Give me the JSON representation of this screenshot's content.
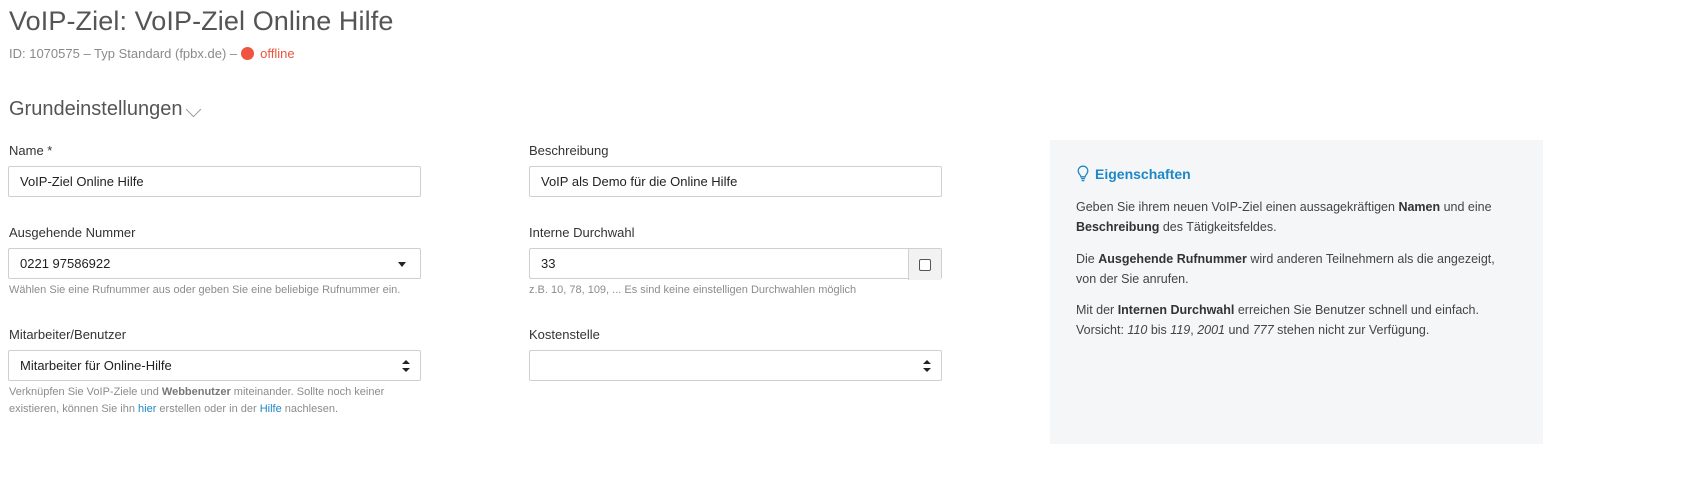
{
  "header": {
    "title": "VoIP-Ziel: VoIP-Ziel Online Hilfe",
    "meta": "ID: 1070575 – Typ Standard (fpbx.de) –",
    "status_label": "offline",
    "status_color": "#f0533f"
  },
  "section": {
    "title": "Grundeinstellungen",
    "toggle_icon": "chevron-down-icon"
  },
  "form": {
    "name": {
      "label": "Name *",
      "value": "VoIP-Ziel Online Hilfe"
    },
    "description": {
      "label": "Beschreibung",
      "value": "VoIP als Demo für die Online Hilfe"
    },
    "outgoing_number": {
      "label": "Ausgehende Nummer",
      "value": "0221 97586922",
      "help": "Wählen Sie eine Rufnummer aus oder geben Sie eine beliebige Rufnummer ein."
    },
    "internal_extension": {
      "label": "Interne Durchwahl",
      "value": "33",
      "help": "z.B. 10, 78, 109, ... Es sind keine einstelligen Durchwahlen möglich",
      "checkbox_checked": false
    },
    "employee": {
      "label": "Mitarbeiter/Benutzer",
      "value": "Mitarbeiter für Online-Hilfe",
      "help": {
        "p1": "Verknüpfen Sie VoIP-Ziele und ",
        "b1": "Webbenutzer",
        "p2": " miteinander. Sollte noch keiner",
        "p3": "existieren, können Sie ihn ",
        "link_here": "hier",
        "p4": " erstellen oder in der ",
        "link_help": "Hilfe",
        "p5": " nachlesen."
      }
    },
    "cost_center": {
      "label": "Kostenstelle",
      "value": ""
    }
  },
  "info_panel": {
    "title": "Eigenschaften",
    "icon": "lightbulb-icon",
    "accent_color": "#1e88c7",
    "p1": {
      "a": "Geben Sie ihrem neuen VoIP-Ziel einen aussagekräftigen ",
      "b": "Namen",
      "c": " und eine",
      "d": "Beschreibung",
      "e": " des Tätigkeitsfeldes."
    },
    "p2": {
      "a": "Die ",
      "b": "Ausgehende Rufnummer",
      "c": " wird anderen Teilnehmern als die angezeigt,",
      "d": "von der Sie anrufen."
    },
    "p3": {
      "a": "Mit der ",
      "b": "Internen Durchwahl",
      "c": " erreichen Sie Benutzer schnell und einfach.",
      "d": "Vorsicht: ",
      "e": "110",
      "f": " bis ",
      "g": "119",
      "h": ", ",
      "i": "2001",
      "j": " und ",
      "k": "777",
      "l": " stehen nicht zur Verfügung."
    }
  }
}
